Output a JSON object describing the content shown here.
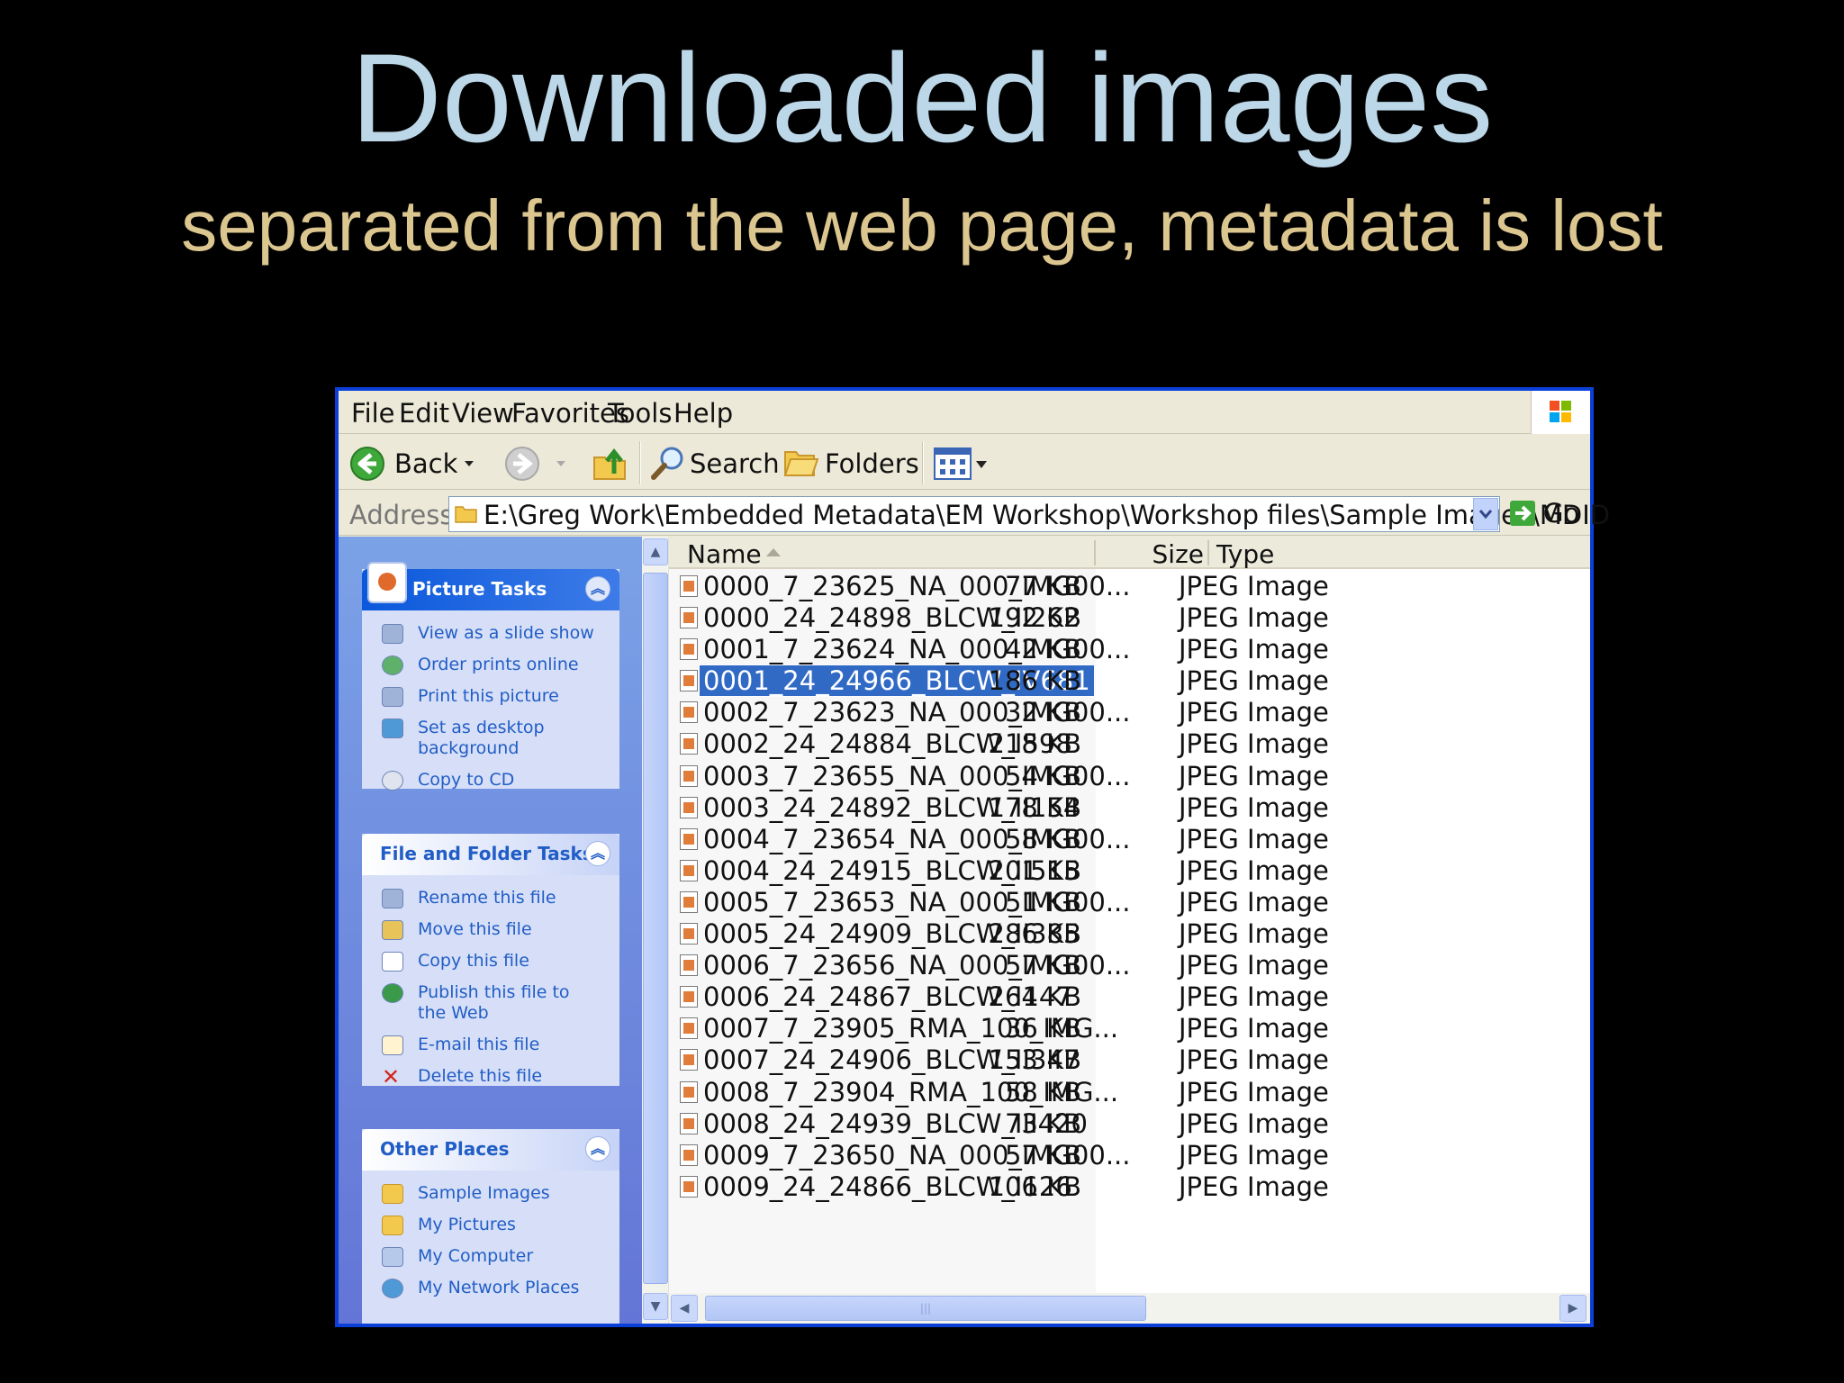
{
  "slide": {
    "title": "Downloaded images",
    "subtitle": "separated from the web page, metadata is lost"
  },
  "menu": [
    "File",
    "Edit",
    "View",
    "Favorites",
    "Tools",
    "Help"
  ],
  "toolbar": {
    "back": "Back",
    "search": "Search",
    "folders": "Folders"
  },
  "address": {
    "label": "Address",
    "value": "E:\\Greg Work\\Embedded Metadata\\EM Workshop\\Workshop files\\Sample Images\\MDID",
    "go": "Go"
  },
  "tasks": {
    "picture": {
      "title": "Picture Tasks",
      "items": [
        "View as a slide show",
        "Order prints online",
        "Print this picture",
        "Set as desktop background",
        "Copy to CD"
      ]
    },
    "file": {
      "title": "File and Folder Tasks",
      "items": [
        "Rename this file",
        "Move this file",
        "Copy this file",
        "Publish this file to the Web",
        "E-mail this file",
        "Delete this file"
      ]
    },
    "other": {
      "title": "Other Places",
      "items": [
        "Sample Images",
        "My Pictures",
        "My Computer",
        "My Network Places"
      ]
    }
  },
  "columns": {
    "name": "Name",
    "size": "Size",
    "type": "Type"
  },
  "files": [
    {
      "name": "0000_7_23625_NA_000_IMG00...",
      "size": "77 KB",
      "type": "JPEG Image"
    },
    {
      "name": "0000_24_24898_BLCW_II262",
      "size": "192 KB",
      "type": "JPEG Image"
    },
    {
      "name": "0001_7_23624_NA_000_IMG00...",
      "size": "42 KB",
      "type": "JPEG Image"
    },
    {
      "name": "0001_24_24966_BLCW_IV681",
      "size": "186 KB",
      "type": "JPEG Image",
      "selected": true
    },
    {
      "name": "0002_7_23623_NA_000_IMG00...",
      "size": "32 KB",
      "type": "JPEG Image"
    },
    {
      "name": "0002_24_24884_BLCW_I598",
      "size": "218 KB",
      "type": "JPEG Image"
    },
    {
      "name": "0003_7_23655_NA_000_IMG00...",
      "size": "54 KB",
      "type": "JPEG Image"
    },
    {
      "name": "0003_24_24892_BLCW_II154",
      "size": "178 KB",
      "type": "JPEG Image"
    },
    {
      "name": "0004_7_23654_NA_000_IMG00...",
      "size": "58 KB",
      "type": "JPEG Image"
    },
    {
      "name": "0004_24_24915_BLCW_II515",
      "size": "201 KB",
      "type": "JPEG Image"
    },
    {
      "name": "0005_7_23653_NA_000_IMG00...",
      "size": "51 KB",
      "type": "JPEG Image"
    },
    {
      "name": "0005_24_24909_BLCW_II385",
      "size": "286 KB",
      "type": "JPEG Image"
    },
    {
      "name": "0006_7_23656_NA_000_IMG00...",
      "size": "57 KB",
      "type": "JPEG Image"
    },
    {
      "name": "0006_24_24867_BLCW_I147",
      "size": "264 KB",
      "type": "JPEG Image"
    },
    {
      "name": "0007_7_23905_RMA_100_IMG...",
      "size": "36 KB",
      "type": "JPEG Image"
    },
    {
      "name": "0007_24_24906_BLCW_II347",
      "size": "153 KB",
      "type": "JPEG Image"
    },
    {
      "name": "0008_7_23904_RMA_100_IMG...",
      "size": "58 KB",
      "type": "JPEG Image"
    },
    {
      "name": "0008_24_24939_BLCW_III420",
      "size": "73 KB",
      "type": "JPEG Image"
    },
    {
      "name": "0009_7_23650_NA_000_IMG00...",
      "size": "57 KB",
      "type": "JPEG Image"
    },
    {
      "name": "0009_24_24866_BLCW_I126",
      "size": "106 KB",
      "type": "JPEG Image"
    }
  ],
  "colors": {
    "title": "#bcd7e8",
    "subtitle": "#dcc68f",
    "selection": "#316ac5",
    "link": "#215dc6"
  }
}
